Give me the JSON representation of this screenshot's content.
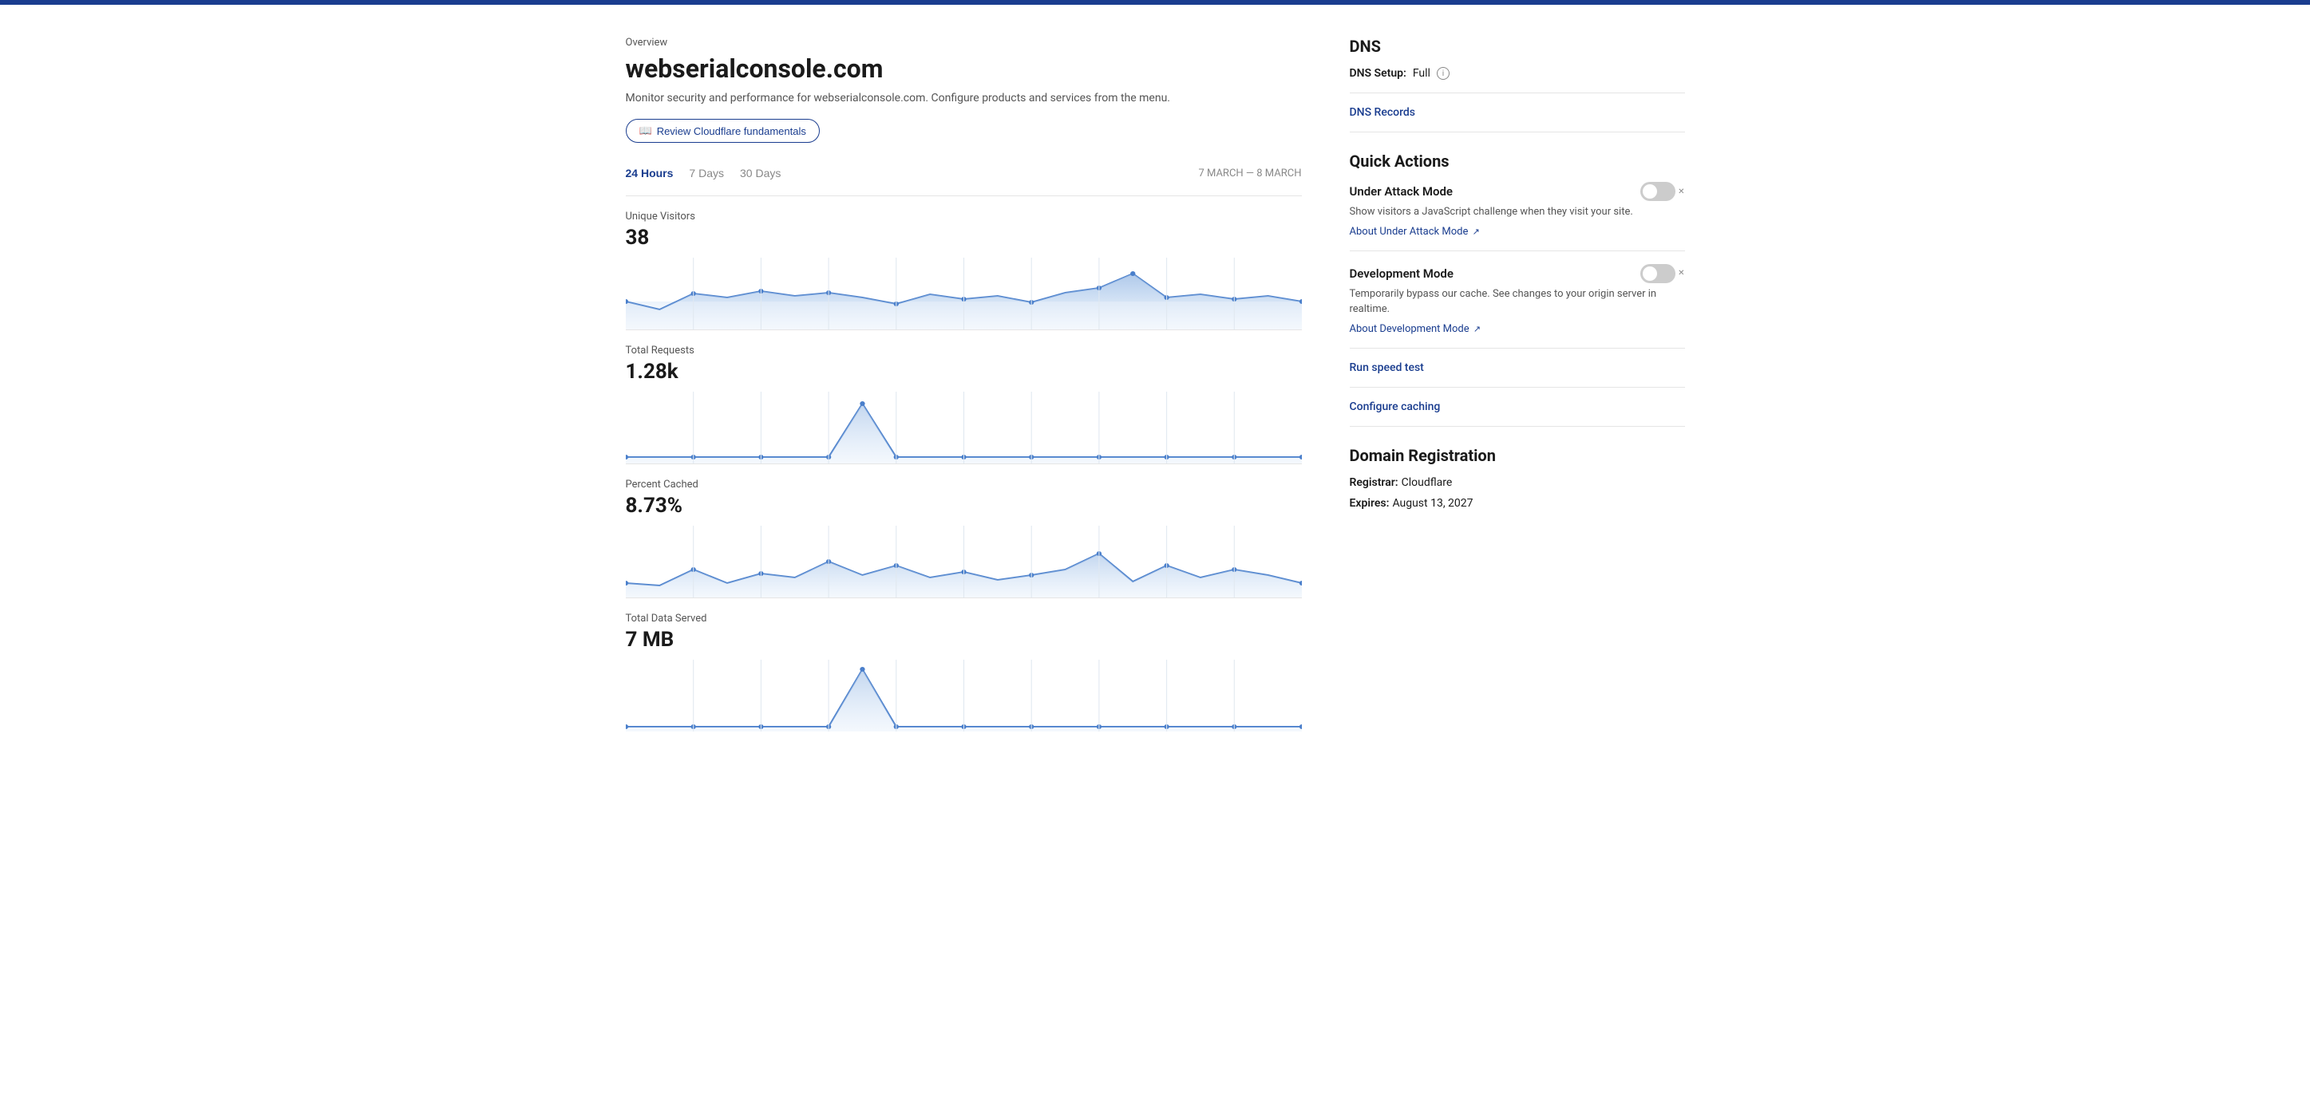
{
  "topbar": {},
  "header": {
    "overview_label": "Overview",
    "site_title": "webserialconsole.com",
    "description": "Monitor security and performance for webserialconsole.com. Configure products and services from the menu.",
    "review_btn_label": "Review Cloudflare fundamentals",
    "book_icon": "📖"
  },
  "time_range": {
    "options": [
      "24 Hours",
      "7 Days",
      "30 Days"
    ],
    "active": "24 Hours",
    "date_range": "7 MARCH — 8 MARCH"
  },
  "charts": [
    {
      "label": "Unique Visitors",
      "value": "38",
      "id": "unique-visitors"
    },
    {
      "label": "Total Requests",
      "value": "1.28k",
      "id": "total-requests"
    },
    {
      "label": "Percent Cached",
      "value": "8.73%",
      "id": "percent-cached"
    },
    {
      "label": "Total Data Served",
      "value": "7 MB",
      "id": "total-data"
    }
  ],
  "dns": {
    "section_title": "DNS",
    "setup_label": "DNS Setup:",
    "setup_value": "Full",
    "records_link": "DNS Records"
  },
  "quick_actions": {
    "section_title": "Quick Actions",
    "items": [
      {
        "title": "Under Attack Mode",
        "description": "Show visitors a JavaScript challenge when they visit your site.",
        "link_label": "About Under Attack Mode",
        "enabled": false
      },
      {
        "title": "Development Mode",
        "description": "Temporarily bypass our cache. See changes to your origin server in realtime.",
        "link_label": "About Development Mode",
        "enabled": false
      }
    ],
    "run_speed_test": "Run speed test",
    "configure_caching": "Configure caching"
  },
  "domain_registration": {
    "section_title": "Domain Registration",
    "registrar_label": "Registrar:",
    "registrar_value": "Cloudflare",
    "expires_label": "Expires:",
    "expires_value": "August 13, 2027"
  }
}
